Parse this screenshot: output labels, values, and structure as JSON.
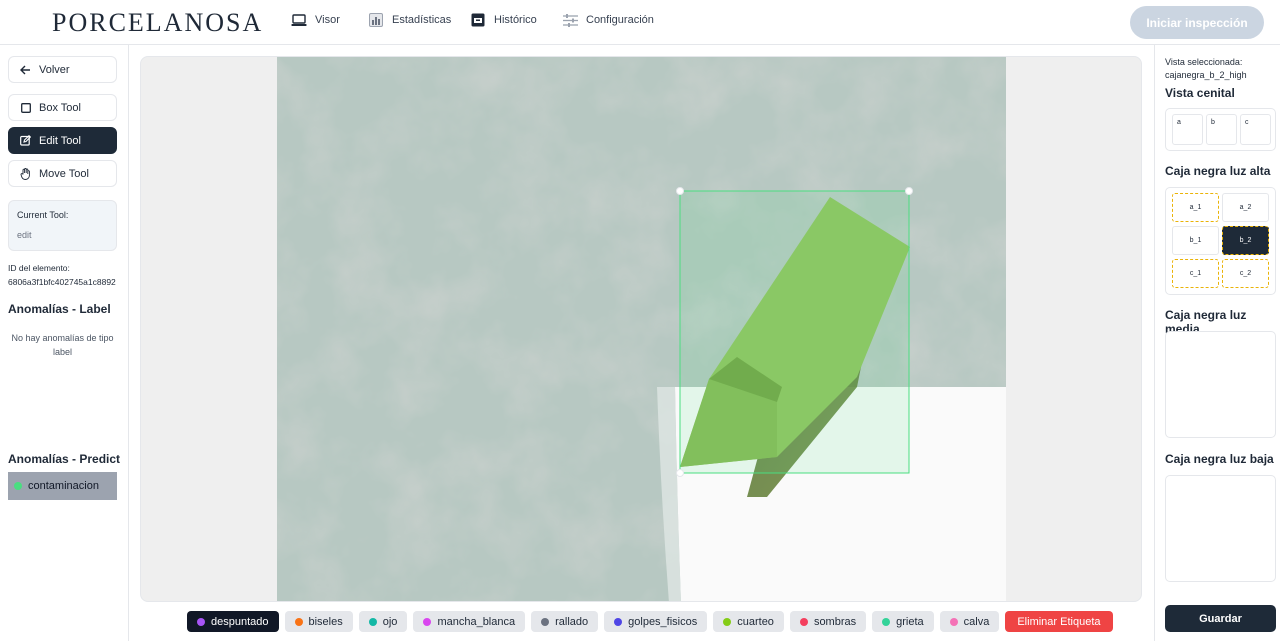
{
  "header": {
    "brand": "PORCELANOSA",
    "nav": [
      {
        "label": "Visor",
        "icon": "laptop-icon"
      },
      {
        "label": "Estadísticas",
        "icon": "bar-chart-icon"
      },
      {
        "label": "Histórico",
        "icon": "archive-icon"
      },
      {
        "label": "Configuración",
        "icon": "sliders-icon"
      }
    ],
    "start_button": "Iniciar inspección"
  },
  "left": {
    "back": "Volver",
    "tools": [
      {
        "label": "Box Tool",
        "icon": "square-icon"
      },
      {
        "label": "Edit Tool",
        "icon": "edit-icon",
        "active": true
      },
      {
        "label": "Move Tool",
        "icon": "hand-icon"
      }
    ],
    "current_tool_label": "Current Tool:",
    "current_tool_value": "edit",
    "element_id_label": "ID del elemento:",
    "element_id_value": "6806a3f1bfc402745a1c8892",
    "anomalies_label_title": "Anomalías - Label",
    "no_anomalies_text": "No hay anomalías de tipo label",
    "anomalies_predict_title": "Anomalías - Predict",
    "predict_items": [
      {
        "label": "contaminacion",
        "color": "#4ade80"
      }
    ]
  },
  "right": {
    "selected_view_label": "Vista seleccionada:",
    "selected_view_value": "cajanegra_b_2_high",
    "cenital_title": "Vista cenital",
    "cenital_cells": [
      "a",
      "b",
      "c"
    ],
    "alta_title": "Caja negra luz alta",
    "alta_cells": [
      "a_1",
      "a_2",
      "b_1",
      "b_2",
      "c_1",
      "c_2"
    ],
    "media_title": "Caja negra luz media",
    "baja_title": "Caja negra luz baja",
    "save_button": "Guardar"
  },
  "labels": [
    {
      "label": "despuntado",
      "color": "#a855f7",
      "active": true
    },
    {
      "label": "biseles",
      "color": "#f97316"
    },
    {
      "label": "ojo",
      "color": "#14b8a6"
    },
    {
      "label": "mancha_blanca",
      "color": "#d946ef"
    },
    {
      "label": "rallado",
      "color": "#6b7280"
    },
    {
      "label": "golpes_fisicos",
      "color": "#4f46e5"
    },
    {
      "label": "cuarteo",
      "color": "#84cc16"
    },
    {
      "label": "sombras",
      "color": "#f43f5e"
    },
    {
      "label": "grieta",
      "color": "#34d399"
    },
    {
      "label": "calva",
      "color": "#f472b6"
    }
  ],
  "delete_label": "Eliminar Etiqueta",
  "colors": {
    "dark": "#1e2a38",
    "bbox": "#4ade80",
    "danger": "#ef4444"
  }
}
